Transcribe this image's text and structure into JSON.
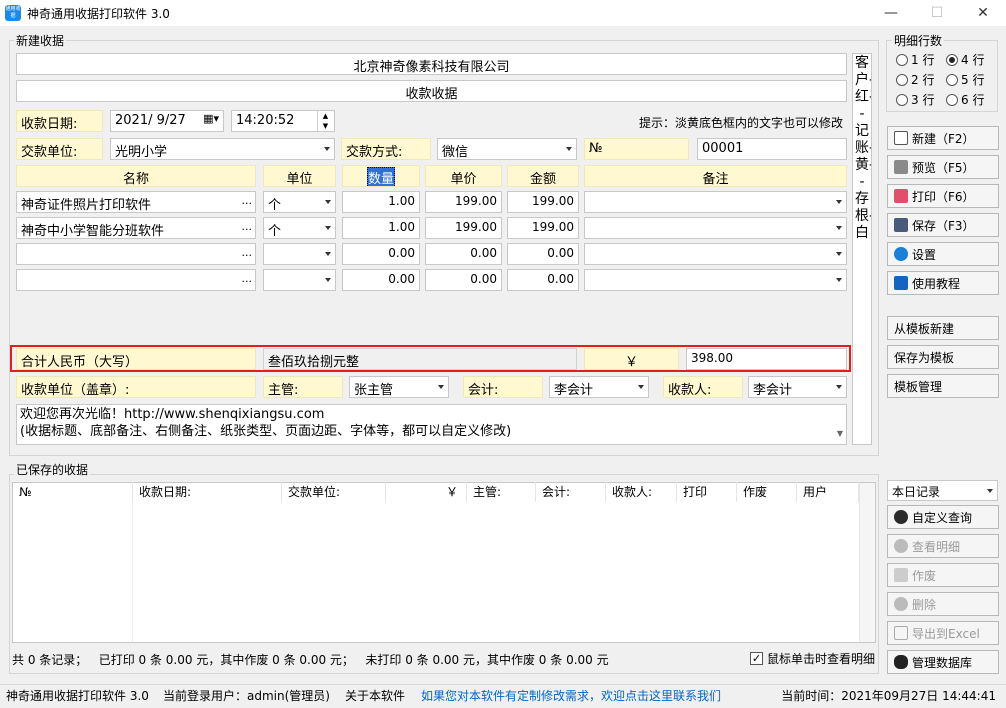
{
  "window": {
    "title": "神奇通用收据打印软件 3.0",
    "icon_text": "通用收据"
  },
  "new_group": {
    "label": "新建收据"
  },
  "company": "北京神奇像素科技有限公司",
  "doc_title": "收款收据",
  "date_label": "收款日期:",
  "date_value": "2021/ 9/27",
  "time_value": "14:20:52",
  "hint": "提示：淡黄底色框内的文字也可以修改",
  "payer_label": "交款单位:",
  "payer_value": "光明小学",
  "pay_method_label": "交款方式:",
  "pay_method_value": "微信",
  "no_label": "№",
  "no_value": "00001",
  "headers": {
    "name": "名称",
    "unit": "单位",
    "qty": "数量",
    "price": "单价",
    "amount": "金额",
    "remark": "备注"
  },
  "rows": [
    {
      "name": "神奇证件照片打印软件",
      "unit": "个",
      "qty": "1.00",
      "price": "199.00",
      "amount": "199.00",
      "remark": ""
    },
    {
      "name": "神奇中小学智能分班软件",
      "unit": "个",
      "qty": "1.00",
      "price": "199.00",
      "amount": "199.00",
      "remark": ""
    },
    {
      "name": "",
      "unit": "",
      "qty": "0.00",
      "price": "0.00",
      "amount": "0.00",
      "remark": ""
    },
    {
      "name": "",
      "unit": "",
      "qty": "0.00",
      "price": "0.00",
      "amount": "0.00",
      "remark": ""
    }
  ],
  "dots_text": "...",
  "total": {
    "label": "合计人民币（大写）",
    "words": "叁佰玖拾捌元整",
    "currency": "￥",
    "amount": "398.00"
  },
  "footer": {
    "seal_label": "收款单位（盖章）:",
    "manager_label": "主管:",
    "manager_value": "张主管",
    "accountant_label": "会计:",
    "accountant_value": "李会计",
    "payee_label": "收款人:",
    "payee_value": "李会计"
  },
  "note_line1": "欢迎您再次光临！http://www.shenqixiangsu.com",
  "note_line2": "(收据标题、底部备注、右侧备注、纸张类型、页面边距、字体等，都可以自定义修改)",
  "side_note": "客户-红--记账-黄--存根-白",
  "rows_group": {
    "label": "明细行数",
    "options": [
      "1 行",
      "4 行",
      "2 行",
      "5 行",
      "3 行",
      "6 行"
    ],
    "selected": "4 行"
  },
  "buttons": {
    "new": "新建（F2）",
    "preview": "预览（F5）",
    "print": "打印（F6）",
    "save": "保存（F3）",
    "settings": "设置",
    "tutorial": "使用教程",
    "from_template": "从模板新建",
    "save_template": "保存为模板",
    "manage_template": "模板管理"
  },
  "saved_group": {
    "label": "已保存的收据"
  },
  "saved_headers": [
    "№",
    "收款日期:",
    "交款单位:",
    "￥",
    "主管:",
    "会计:",
    "收款人:",
    "打印",
    "作废",
    "用户"
  ],
  "filter_value": "本日记录",
  "saved_buttons": {
    "custom_query": "自定义查询",
    "view_detail": "查看明细",
    "void": "作废",
    "delete": "删除",
    "export": "导出到Excel",
    "manage_db": "管理数据库"
  },
  "summary": "共 0 条记录；   已打印 0 条 0.00 元，其中作废 0 条 0.00 元；   未打印 0 条 0.00 元，其中作废 0 条 0.00 元",
  "click_option": "鼠标单击时查看明细",
  "status": {
    "app": "神奇通用收据打印软件 3.0",
    "user": "当前登录用户：admin(管理员)",
    "about": "关于本软件",
    "contact": "如果您对本软件有定制修改需求，欢迎点击这里联系我们",
    "time": "当前时间：2021年09月27日 14:44:41"
  },
  "colors": {
    "link": "#0066cc",
    "yellow_bg": "#fff8d0",
    "highlight_border": "#e02020",
    "selected_header": "#2f6fd6"
  }
}
